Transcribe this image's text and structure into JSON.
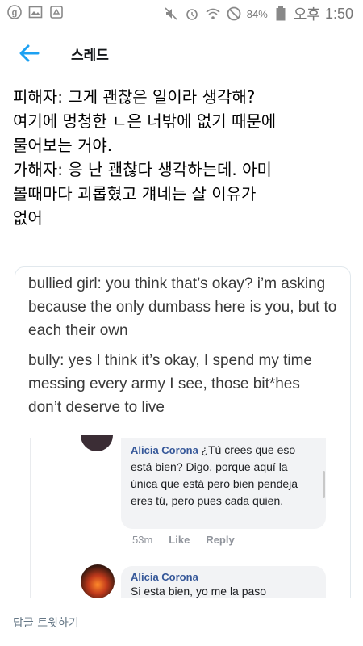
{
  "status_bar": {
    "battery": "84%",
    "ampm": "오후",
    "time": "1:50",
    "icons": [
      "g-app-icon",
      "gallery-icon",
      "recycle-icon",
      "mute-icon",
      "alarm-icon",
      "wifi-icon",
      "do-not-disturb-icon",
      "battery-icon"
    ]
  },
  "header": {
    "back_icon": "back-arrow-icon",
    "title": "스레드",
    "accent": "#1da1f2"
  },
  "tweet": {
    "lines": [
      "피해자: 그게 괜찮은 일이라 생각해?",
      "여기에 멍청한 ㄴ은 너밖에 없기 때문에",
      "물어보는 거야.",
      "가해자: 응 난 괜찮다 생각하는데. 아미",
      "볼때마다 괴롭혔고 걔네는 살 이유가",
      "없어"
    ]
  },
  "media": {
    "translation_1": "bullied girl: you think that’s okay? i’m asking because the only dumbass here is you, but to each their own",
    "translation_2": "bully: yes I think it’s okay, I spend my time messing every army I see, those bit*hes don’t deserve to live",
    "comment_1": {
      "name": "Alicia Corona",
      "text": "¿Tú crees que eso está bien? Digo, porque aquí la única que está pero bien pendeja eres tú, pero pues cada quien.",
      "time": "53m",
      "like": "Like",
      "reply": "Reply"
    },
    "comment_2": {
      "name": "Alicia Corona",
      "text": "Si esta bien, yo me la paso"
    }
  },
  "reply_bar": {
    "placeholder": "답글 트윗하기"
  }
}
